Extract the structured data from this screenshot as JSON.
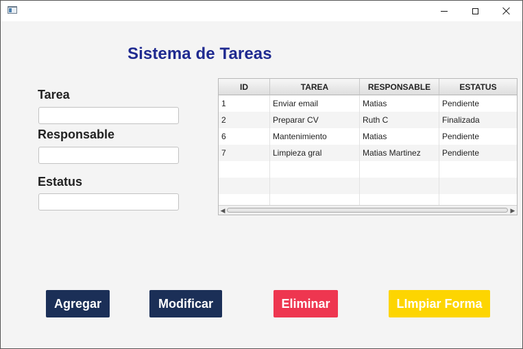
{
  "window": {
    "title": ""
  },
  "app": {
    "title": "Sistema de Tareas"
  },
  "form": {
    "tarea_label": "Tarea",
    "tarea_value": "",
    "responsable_label": "Responsable",
    "responsable_value": "",
    "estatus_label": "Estatus",
    "estatus_value": ""
  },
  "table": {
    "columns": [
      "ID",
      "TAREA",
      "RESPONSABLE",
      "ESTATUS"
    ],
    "rows": [
      [
        "1",
        "Enviar email",
        "Matias",
        "Pendiente"
      ],
      [
        "2",
        "Preparar CV",
        "Ruth C",
        "Finalizada"
      ],
      [
        "6",
        "Mantenimiento",
        "Matias",
        "Pendiente"
      ],
      [
        "7",
        "Limpieza gral",
        "Matias Martinez",
        "Pendiente"
      ]
    ]
  },
  "buttons": {
    "add_label": "Agregar",
    "edit_label": "Modificar",
    "delete_label": "Eliminar",
    "clear_label": "LImpiar Forma"
  },
  "colors": {
    "title": "#1f2a90",
    "add": "#1b2f57",
    "edit": "#1b2f57",
    "delete": "#ee3650",
    "clear": "#fdd501"
  }
}
